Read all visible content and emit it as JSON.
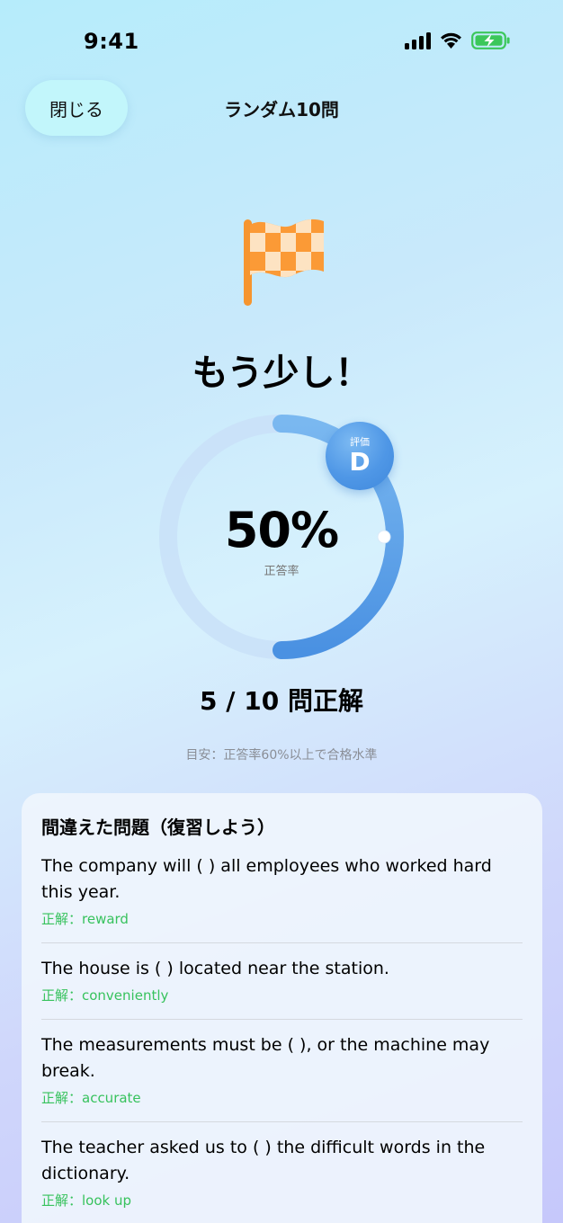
{
  "status_bar": {
    "time": "9:41"
  },
  "header": {
    "close_label": "閉じる",
    "title": "ランダム10問"
  },
  "result": {
    "title": "もう少し！",
    "percent_text": "50%",
    "percent_value": 50,
    "percent_label": "正答率",
    "grade_label": "評価",
    "grade": "D",
    "score_text": "5 / 10 問正解",
    "guideline": "目安：正答率60%以上で合格水準"
  },
  "review": {
    "title": "間違えた問題（復習しよう）",
    "items": [
      {
        "question": "The company will ( ) all employees who worked hard this year.",
        "answer": "正解：reward"
      },
      {
        "question": "The house is ( ) located near the station.",
        "answer": "正解：conveniently"
      },
      {
        "question": "The measurements must be ( ), or the machine may break.",
        "answer": "正解：accurate"
      },
      {
        "question": "The teacher asked us to ( ) the difficult words in the dictionary.",
        "answer": "正解：look up"
      }
    ]
  },
  "colors": {
    "accent_blue": "#4f97e6",
    "track_blue": "#c7def8",
    "correct_green": "#37c25d",
    "flag_orange": "#fb9a36",
    "close_button_bg": "#c2f6fb"
  },
  "icons": {
    "flag": "checkered-flag-icon",
    "signal": "cellular-signal-icon",
    "wifi": "wifi-icon",
    "battery": "battery-charging-icon"
  }
}
